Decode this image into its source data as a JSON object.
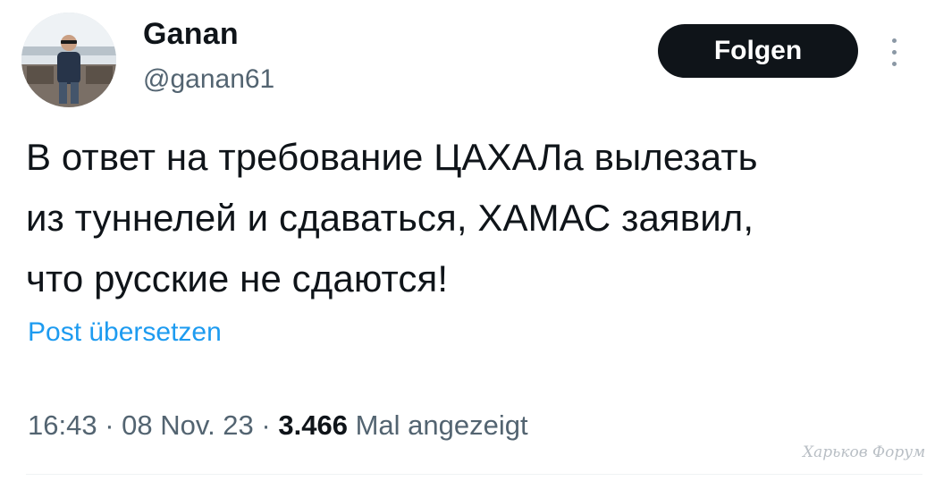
{
  "author": {
    "display_name": "Ganan",
    "handle": "@ganan61"
  },
  "follow_button": {
    "label": "Folgen"
  },
  "more_button": {
    "icon": "more-vertical-icon"
  },
  "tweet": {
    "text_lines": [
      "В ответ на требование ЦАХАЛа вылезать",
      "из туннелей и сдаваться, ХАМАС заявил,",
      "что русские не сдаются!"
    ],
    "translate_label": "Post übersetzen",
    "time": "16:43",
    "date": "08 Nov. 23",
    "separator": "·",
    "views_count": "3.466",
    "views_label": "Mal angezeigt"
  },
  "watermark": {
    "text": "Харьков Форум"
  },
  "colors": {
    "text_primary": "#0f1419",
    "text_secondary": "#536471",
    "link_blue": "#1d9bf0",
    "button_bg": "#0f1419",
    "button_text": "#ffffff"
  }
}
